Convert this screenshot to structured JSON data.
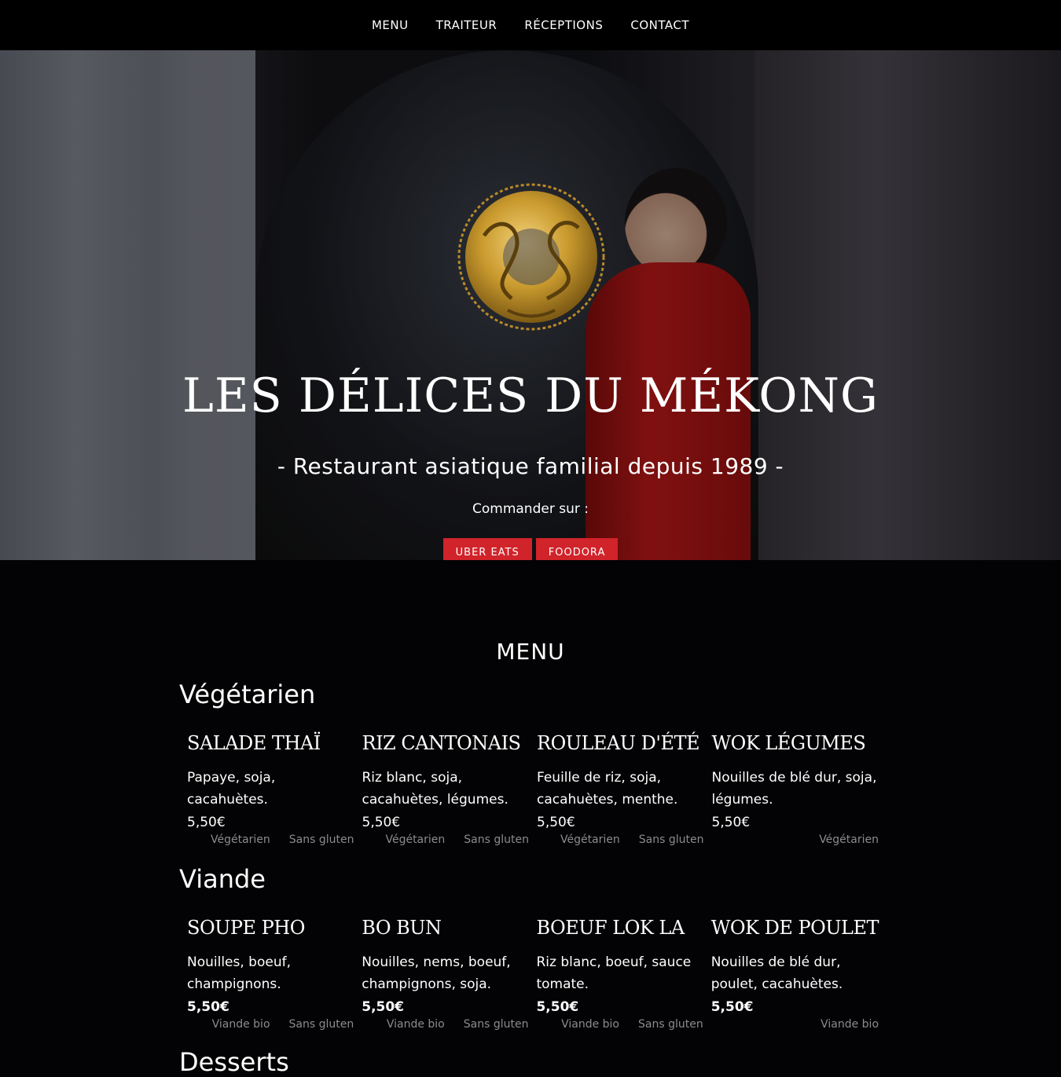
{
  "nav": {
    "items": [
      "MENU",
      "TRAITEUR",
      "RÉCEPTIONS",
      "CONTACT"
    ]
  },
  "hero": {
    "title": "LES DÉLICES DU MÉKONG",
    "subtitle": "- Restaurant asiatique familial depuis 1989 -",
    "order_label": "Commander sur :",
    "buttons": [
      "UBER EATS",
      "FOODORA"
    ],
    "emblem_color": "#c99a2e"
  },
  "menu": {
    "heading": "MENU",
    "categories": [
      {
        "name": "Végétarien",
        "items": [
          {
            "name": "SALADE THAÏ",
            "desc": "Papaye, soja, cacahuètes.",
            "price": "5,50€",
            "tags": [
              "Végétarien",
              "Sans gluten"
            ]
          },
          {
            "name": "RIZ CANTONAIS",
            "desc": "Riz blanc, soja, cacahuètes, légumes.",
            "price": "5,50€",
            "tags": [
              "Végétarien",
              "Sans gluten"
            ]
          },
          {
            "name": "ROULEAU D'ÉTÉ",
            "desc": "Feuille de riz, soja, cacahuètes, menthe.",
            "price": "5,50€",
            "tags": [
              "Végétarien",
              "Sans gluten"
            ]
          },
          {
            "name": "WOK LÉGUMES",
            "desc": "Nouilles de blé dur, soja, légumes.",
            "price": "5,50€",
            "tags": [
              "Végétarien"
            ]
          }
        ]
      },
      {
        "name": "Viande",
        "items": [
          {
            "name": "SOUPE PHO",
            "desc": "Nouilles, boeuf, champignons.",
            "price": "5,50€",
            "tags": [
              "Viande bio",
              "Sans gluten"
            ]
          },
          {
            "name": "BO BUN",
            "desc": "Nouilles, nems, boeuf, champignons, soja.",
            "price": "5,50€",
            "tags": [
              "Viande bio",
              "Sans gluten"
            ]
          },
          {
            "name": "BOEUF LOK LA",
            "desc": "Riz blanc, boeuf, sauce tomate.",
            "price": "5,50€",
            "tags": [
              "Viande bio",
              "Sans gluten"
            ]
          },
          {
            "name": "WOK DE POULET",
            "desc": "Nouilles de blé dur, poulet, cacahuètes.",
            "price": "5,50€",
            "tags": [
              "Viande bio"
            ]
          }
        ]
      }
    ],
    "next_category_peek": "Desserts"
  },
  "colors": {
    "accent": "#d1232a",
    "background": "#030204",
    "tag": "#8c8c8c"
  }
}
